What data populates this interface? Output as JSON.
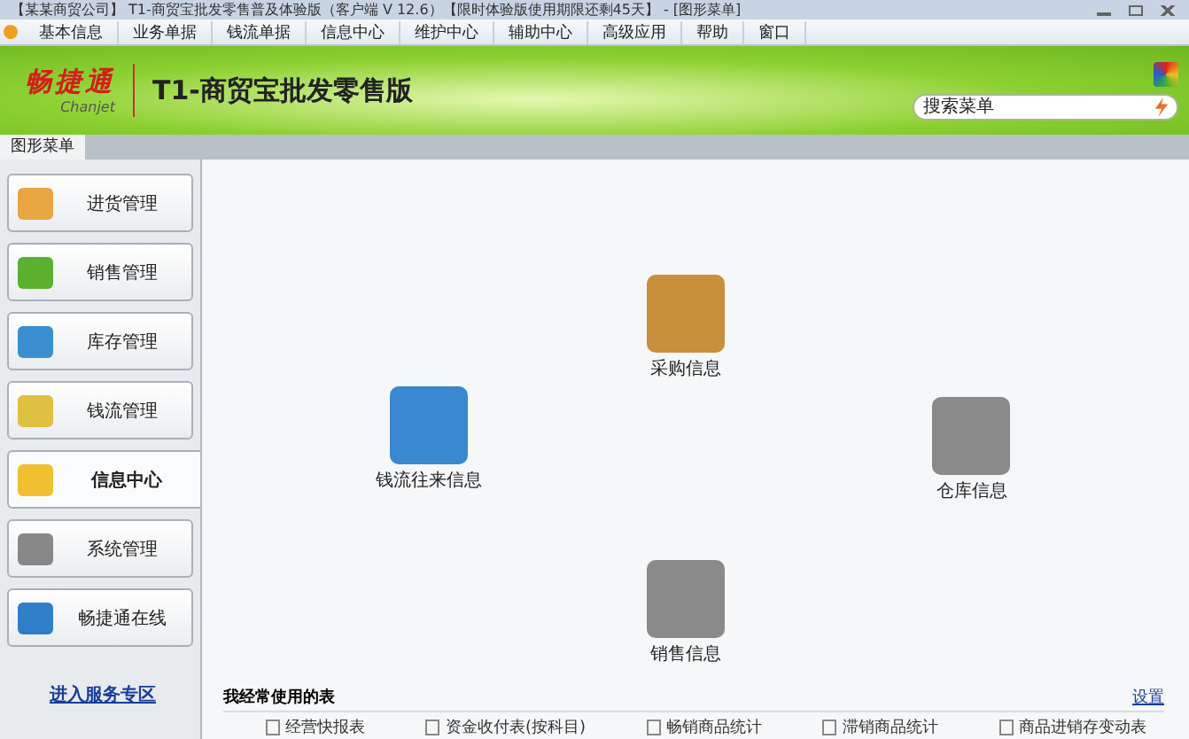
{
  "window": {
    "title": "【某某商贸公司】 T1-商贸宝批发零售普及体验版（客户端 V 12.6）【限时体验版使用期限还剩45天】 - [图形菜单]"
  },
  "menu": [
    "基本信息",
    "业务单据",
    "钱流单据",
    "信息中心",
    "维护中心",
    "辅助中心",
    "高级应用",
    "帮助",
    "窗口"
  ],
  "banner": {
    "logo": "畅捷通",
    "logo_sub": "Chanjet",
    "product": "T1-商贸宝批发零售版",
    "search": {
      "placeholder": "搜索菜单"
    }
  },
  "tabs": [
    {
      "label": "图形菜单",
      "selected": true
    }
  ],
  "sidebar": {
    "items": [
      {
        "label": "进货管理",
        "selected": false
      },
      {
        "label": "销售管理",
        "selected": false
      },
      {
        "label": "库存管理",
        "selected": false
      },
      {
        "label": "钱流管理",
        "selected": false
      },
      {
        "label": "信息中心",
        "selected": true
      },
      {
        "label": "系统管理",
        "selected": false
      },
      {
        "label": "畅捷通在线",
        "selected": false
      }
    ],
    "link": "进入服务专区"
  },
  "nodes": [
    {
      "label": "采购信息"
    },
    {
      "label": "钱流往来信息"
    },
    {
      "label": "仓库信息"
    },
    {
      "label": "销售信息"
    }
  ],
  "frequent": {
    "title": "我经常使用的表",
    "settings": "设置",
    "items": [
      "经营快报表",
      "资金收付表(按科目)",
      "畅销商品统计",
      "滞销商品统计",
      "商品进销存变动表"
    ]
  }
}
